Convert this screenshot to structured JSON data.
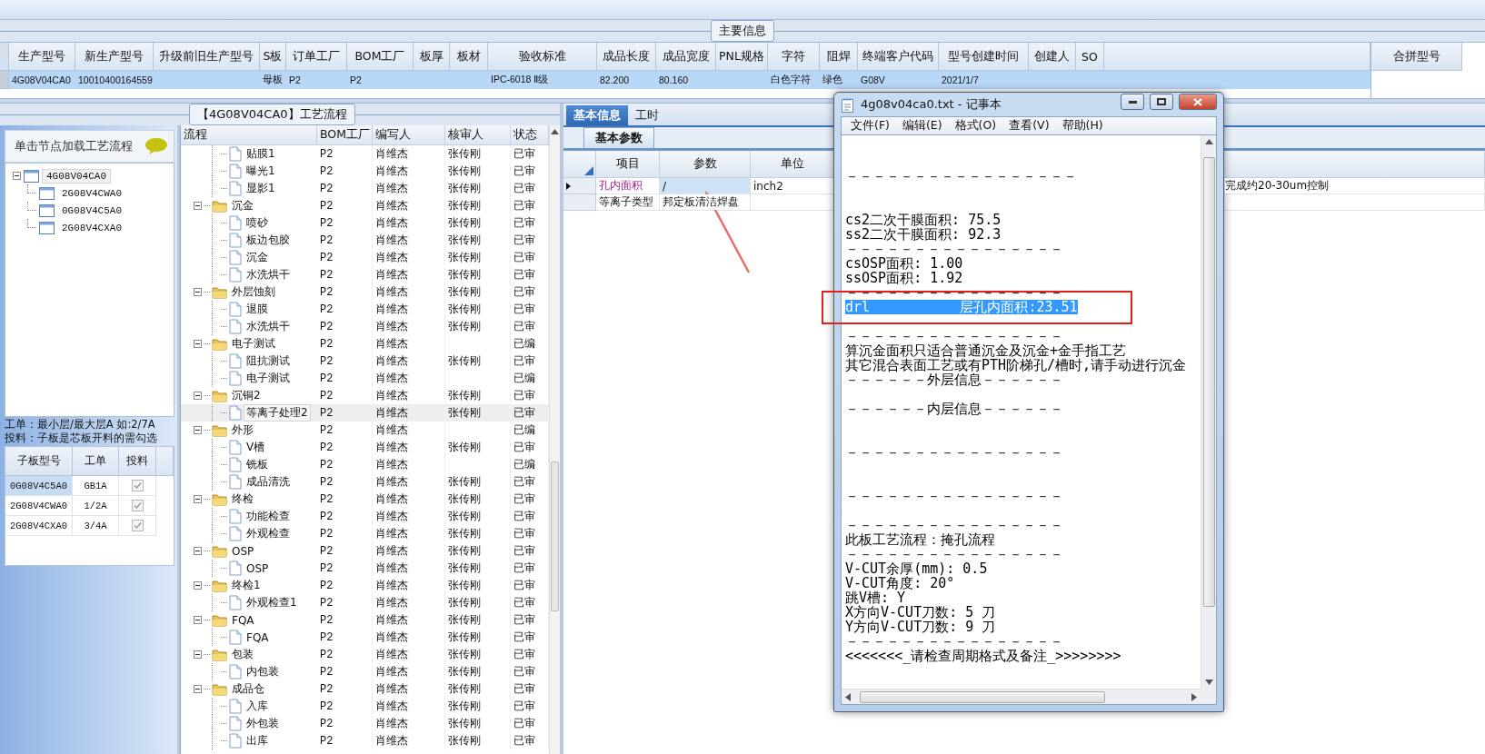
{
  "main_info": {
    "title": "主要信息",
    "columns": [
      "生产型号",
      "新生产型号",
      "升级前旧生产型号",
      "S板",
      "订单工厂",
      "BOM工厂",
      "板厚",
      "板材",
      "验收标准",
      "成品长度",
      "成品宽度",
      "PNL规格",
      "字符",
      "阻焊",
      "终端客户代码",
      "型号创建时间",
      "创建人",
      "SO"
    ],
    "rows": [
      {
        "selected": true,
        "cells": [
          "4G08V04CA0",
          "10010400164559",
          null,
          "母板",
          "P2",
          "P2",
          null,
          null,
          "IPC-6018 Ⅱ级",
          "82.200",
          "80.160",
          null,
          "白色字符",
          "绿色",
          "G08V",
          "2021/1/7",
          null,
          null
        ]
      }
    ]
  },
  "merge_panel": {
    "column": "合拼型号"
  },
  "left_panel": {
    "hint": "单击节点加载工艺流程",
    "tree": [
      {
        "label": "4G08V04CA0",
        "expanded": true,
        "selected": true,
        "children": [
          {
            "label": "2G08V4CWA0",
            "selected": false
          },
          {
            "label": "0G08V4C5A0",
            "selected": false
          },
          {
            "label": "2G08V4CXA0",
            "selected": false
          }
        ]
      }
    ],
    "notes": [
      "工单：最小层/最大层A 如:2/7A",
      "投料：子板是芯板开料的需勾选"
    ],
    "subboards": {
      "columns": [
        "子板型号",
        "工单",
        "投料"
      ],
      "rows": [
        {
          "cells": [
            "0G08V4C5A0",
            "GB1A"
          ],
          "checked": true,
          "selected": true
        },
        {
          "cells": [
            "2G08V4CWA0",
            "1/2A"
          ],
          "checked": true,
          "selected": false
        },
        {
          "cells": [
            "2G08V4CXA0",
            "3/4A"
          ],
          "checked": true,
          "selected": false
        }
      ]
    }
  },
  "process": {
    "title": "【4G08V04CA0】工艺流程",
    "columns": [
      "流程",
      "BOM工厂",
      "编写人",
      "核审人",
      "状态"
    ],
    "groups": [
      {
        "children": [
          {
            "cells": [
              "贴膜1",
              "P2",
              "肖维杰",
              "张传刚",
              "已审"
            ],
            "selected": false
          },
          {
            "cells": [
              "曝光1",
              "P2",
              "肖维杰",
              "张传刚",
              "已审"
            ],
            "selected": false
          },
          {
            "cells": [
              "显影1",
              "P2",
              "肖维杰",
              "张传刚",
              "已审"
            ],
            "selected": false
          }
        ]
      },
      {
        "cells": [
          "沉金",
          "P2",
          "肖维杰",
          "张传刚",
          "已审"
        ],
        "selected": false,
        "expanded": true,
        "children": [
          {
            "cells": [
              "喷砂",
              "P2",
              "肖维杰",
              "张传刚",
              "已审"
            ],
            "selected": false
          },
          {
            "cells": [
              "板边包胶",
              "P2",
              "肖维杰",
              "张传刚",
              "已审"
            ],
            "selected": false
          },
          {
            "cells": [
              "沉金",
              "P2",
              "肖维杰",
              "张传刚",
              "已审"
            ],
            "selected": false
          },
          {
            "cells": [
              "水洗烘干",
              "P2",
              "肖维杰",
              "张传刚",
              "已审"
            ],
            "selected": false
          }
        ]
      },
      {
        "cells": [
          "外层蚀刻",
          "P2",
          "肖维杰",
          "张传刚",
          "已审"
        ],
        "selected": false,
        "expanded": true,
        "children": [
          {
            "cells": [
              "退膜",
              "P2",
              "肖维杰",
              "张传刚",
              "已审"
            ],
            "selected": false
          },
          {
            "cells": [
              "水洗烘干",
              "P2",
              "肖维杰",
              "张传刚",
              "已审"
            ],
            "selected": false
          }
        ]
      },
      {
        "cells": [
          "电子测试",
          "P2",
          "肖维杰",
          null,
          "已编"
        ],
        "selected": false,
        "expanded": true,
        "children": [
          {
            "cells": [
              "阻抗测试",
              "P2",
              "肖维杰",
              "张传刚",
              "已审"
            ],
            "selected": false
          },
          {
            "cells": [
              "电子测试",
              "P2",
              "肖维杰",
              null,
              "已编"
            ],
            "selected": false
          }
        ]
      },
      {
        "cells": [
          "沉铜2",
          "P2",
          "肖维杰",
          "张传刚",
          "已审"
        ],
        "selected": false,
        "expanded": true,
        "children": [
          {
            "cells": [
              "等离子处理2",
              "P2",
              "肖维杰",
              "张传刚",
              "已审"
            ],
            "selected": true
          }
        ]
      },
      {
        "cells": [
          "外形",
          "P2",
          "肖维杰",
          null,
          "已编"
        ],
        "selected": false,
        "expanded": true,
        "children": [
          {
            "cells": [
              "V槽",
              "P2",
              "肖维杰",
              "张传刚",
              "已审"
            ],
            "selected": false
          },
          {
            "cells": [
              "铣板",
              "P2",
              "肖维杰",
              null,
              "已编"
            ],
            "selected": false
          },
          {
            "cells": [
              "成品清洗",
              "P2",
              "肖维杰",
              "张传刚",
              "已审"
            ],
            "selected": false
          }
        ]
      },
      {
        "cells": [
          "终检",
          "P2",
          "肖维杰",
          "张传刚",
          "已审"
        ],
        "selected": false,
        "expanded": true,
        "children": [
          {
            "cells": [
              "功能检查",
              "P2",
              "肖维杰",
              "张传刚",
              "已审"
            ],
            "selected": false
          },
          {
            "cells": [
              "外观检查",
              "P2",
              "肖维杰",
              "张传刚",
              "已审"
            ],
            "selected": false
          }
        ]
      },
      {
        "cells": [
          "OSP",
          "P2",
          "肖维杰",
          "张传刚",
          "已审"
        ],
        "selected": false,
        "expanded": true,
        "children": [
          {
            "cells": [
              "OSP",
              "P2",
              "肖维杰",
              "张传刚",
              "已审"
            ],
            "selected": false
          }
        ]
      },
      {
        "cells": [
          "终检1",
          "P2",
          "肖维杰",
          "张传刚",
          "已审"
        ],
        "selected": false,
        "expanded": true,
        "children": [
          {
            "cells": [
              "外观检查1",
              "P2",
              "肖维杰",
              "张传刚",
              "已审"
            ],
            "selected": false
          }
        ]
      },
      {
        "cells": [
          "FQA",
          "P2",
          "肖维杰",
          "张传刚",
          "已审"
        ],
        "selected": false,
        "expanded": true,
        "children": [
          {
            "cells": [
              "FQA",
              "P2",
              "肖维杰",
              "张传刚",
              "已审"
            ],
            "selected": false
          }
        ]
      },
      {
        "cells": [
          "包装",
          "P2",
          "肖维杰",
          "张传刚",
          "已审"
        ],
        "selected": false,
        "expanded": true,
        "children": [
          {
            "cells": [
              "内包装",
              "P2",
              "肖维杰",
              "张传刚",
              "已审"
            ],
            "selected": false
          }
        ]
      },
      {
        "cells": [
          "成品仓",
          "P2",
          "肖维杰",
          "张传刚",
          "已审"
        ],
        "selected": false,
        "expanded": true,
        "children": [
          {
            "cells": [
              "入库",
              "P2",
              "肖维杰",
              "张传刚",
              "已审"
            ],
            "selected": false
          },
          {
            "cells": [
              "外包装",
              "P2",
              "肖维杰",
              "张传刚",
              "已审"
            ],
            "selected": false
          },
          {
            "cells": [
              "出库",
              "P2",
              "肖维杰",
              "张传刚",
              "已审"
            ],
            "selected": false
          }
        ]
      }
    ]
  },
  "detail": {
    "tabs": [
      {
        "label": "基本信息",
        "selected": true
      },
      {
        "label": "工时",
        "selected": false
      }
    ],
    "subtabs": [
      {
        "label": "基本参数",
        "selected": true
      }
    ],
    "columns": [
      "项目",
      "参数",
      "单位"
    ],
    "rows": [
      {
        "cells": [
          "孔内面积",
          "/",
          "inch2",
          "完成约20-30um控制"
        ],
        "selected": true
      },
      {
        "cells": [
          "等离子类型",
          "邦定板清洁焊盘"
        ],
        "selected": false
      }
    ]
  },
  "notepad": {
    "title": "4g08v04ca0.txt - 记事本",
    "menu": [
      "文件(F)",
      "编辑(E)",
      "格式(O)",
      "查看(V)",
      "帮助(H)"
    ],
    "lines": [
      {
        "kind": "blank"
      },
      {
        "kind": "blank"
      },
      {
        "kind": "text",
        "text": "－－－－－－－－－－－－－－－－－",
        "selected": false
      },
      {
        "kind": "blank"
      },
      {
        "kind": "blank"
      },
      {
        "kind": "text",
        "text": "cs2二次干膜面积: 75.5",
        "selected": false
      },
      {
        "kind": "text",
        "text": "ss2二次干膜面积: 92.3",
        "selected": false
      },
      {
        "kind": "text",
        "text": "－－－－－－－－－－－－－－－－",
        "selected": false
      },
      {
        "kind": "text",
        "text": "csOSP面积: 1.00",
        "selected": false
      },
      {
        "kind": "text",
        "text": "ssOSP面积: 1.92",
        "selected": false
      },
      {
        "kind": "text",
        "text": "－－－－－－－－－－－－－－－－",
        "selected": false
      },
      {
        "kind": "text",
        "text": "drl           层孔内面积:23.51",
        "selected": true
      },
      {
        "kind": "blank"
      },
      {
        "kind": "text",
        "text": "－－－－－－－－－－－－－－－－",
        "selected": false
      },
      {
        "kind": "text",
        "text": "算沉金面积只适合普通沉金及沉金+金手指工艺",
        "selected": false
      },
      {
        "kind": "text",
        "text": "其它混合表面工艺或有PTH阶梯孔/槽时,请手动进行沉金",
        "selected": false
      },
      {
        "kind": "text",
        "text": "－－－－－－外层信息－－－－－－",
        "selected": false
      },
      {
        "kind": "blank"
      },
      {
        "kind": "text",
        "text": "－－－－－－内层信息－－－－－－",
        "selected": false
      },
      {
        "kind": "blank"
      },
      {
        "kind": "blank"
      },
      {
        "kind": "text",
        "text": "－－－－－－－－－－－－－－－－",
        "selected": false
      },
      {
        "kind": "blank"
      },
      {
        "kind": "blank"
      },
      {
        "kind": "text",
        "text": "－－－－－－－－－－－－－－－－",
        "selected": false
      },
      {
        "kind": "blank"
      },
      {
        "kind": "text",
        "text": "－－－－－－－－－－－－－－－－",
        "selected": false
      },
      {
        "kind": "text",
        "text": "此板工艺流程：掩孔流程",
        "selected": false
      },
      {
        "kind": "text",
        "text": "－－－－－－－－－－－－－－－－",
        "selected": false
      },
      {
        "kind": "text",
        "text": "V-CUT余厚(mm): 0.5",
        "selected": false
      },
      {
        "kind": "text",
        "text": "V-CUT角度: 20°",
        "selected": false
      },
      {
        "kind": "text",
        "text": "跳V槽: Y",
        "selected": false
      },
      {
        "kind": "text",
        "text": "X方向V-CUT刀数: 5 刀",
        "selected": false
      },
      {
        "kind": "text",
        "text": "Y方向V-CUT刀数: 9 刀",
        "selected": false
      },
      {
        "kind": "text",
        "text": "－－－－－－－－－－－－－－－－",
        "selected": false
      },
      {
        "kind": "text",
        "text": "<<<<<<<_请检查周期格式及备注_>>>>>>>>",
        "selected": false
      }
    ]
  }
}
